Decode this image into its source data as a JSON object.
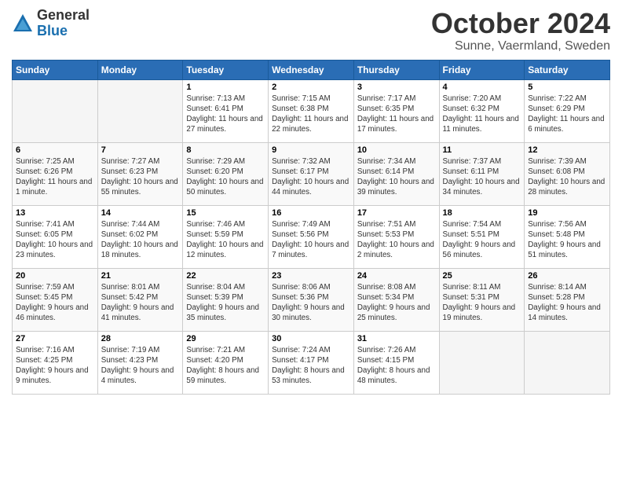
{
  "logo": {
    "general": "General",
    "blue": "Blue"
  },
  "title": "October 2024",
  "location": "Sunne, Vaermland, Sweden",
  "headers": [
    "Sunday",
    "Monday",
    "Tuesday",
    "Wednesday",
    "Thursday",
    "Friday",
    "Saturday"
  ],
  "weeks": [
    [
      {
        "day": "",
        "info": ""
      },
      {
        "day": "",
        "info": ""
      },
      {
        "day": "1",
        "info": "Sunrise: 7:13 AM\nSunset: 6:41 PM\nDaylight: 11 hours and 27 minutes."
      },
      {
        "day": "2",
        "info": "Sunrise: 7:15 AM\nSunset: 6:38 PM\nDaylight: 11 hours and 22 minutes."
      },
      {
        "day": "3",
        "info": "Sunrise: 7:17 AM\nSunset: 6:35 PM\nDaylight: 11 hours and 17 minutes."
      },
      {
        "day": "4",
        "info": "Sunrise: 7:20 AM\nSunset: 6:32 PM\nDaylight: 11 hours and 11 minutes."
      },
      {
        "day": "5",
        "info": "Sunrise: 7:22 AM\nSunset: 6:29 PM\nDaylight: 11 hours and 6 minutes."
      }
    ],
    [
      {
        "day": "6",
        "info": "Sunrise: 7:25 AM\nSunset: 6:26 PM\nDaylight: 11 hours and 1 minute."
      },
      {
        "day": "7",
        "info": "Sunrise: 7:27 AM\nSunset: 6:23 PM\nDaylight: 10 hours and 55 minutes."
      },
      {
        "day": "8",
        "info": "Sunrise: 7:29 AM\nSunset: 6:20 PM\nDaylight: 10 hours and 50 minutes."
      },
      {
        "day": "9",
        "info": "Sunrise: 7:32 AM\nSunset: 6:17 PM\nDaylight: 10 hours and 44 minutes."
      },
      {
        "day": "10",
        "info": "Sunrise: 7:34 AM\nSunset: 6:14 PM\nDaylight: 10 hours and 39 minutes."
      },
      {
        "day": "11",
        "info": "Sunrise: 7:37 AM\nSunset: 6:11 PM\nDaylight: 10 hours and 34 minutes."
      },
      {
        "day": "12",
        "info": "Sunrise: 7:39 AM\nSunset: 6:08 PM\nDaylight: 10 hours and 28 minutes."
      }
    ],
    [
      {
        "day": "13",
        "info": "Sunrise: 7:41 AM\nSunset: 6:05 PM\nDaylight: 10 hours and 23 minutes."
      },
      {
        "day": "14",
        "info": "Sunrise: 7:44 AM\nSunset: 6:02 PM\nDaylight: 10 hours and 18 minutes."
      },
      {
        "day": "15",
        "info": "Sunrise: 7:46 AM\nSunset: 5:59 PM\nDaylight: 10 hours and 12 minutes."
      },
      {
        "day": "16",
        "info": "Sunrise: 7:49 AM\nSunset: 5:56 PM\nDaylight: 10 hours and 7 minutes."
      },
      {
        "day": "17",
        "info": "Sunrise: 7:51 AM\nSunset: 5:53 PM\nDaylight: 10 hours and 2 minutes."
      },
      {
        "day": "18",
        "info": "Sunrise: 7:54 AM\nSunset: 5:51 PM\nDaylight: 9 hours and 56 minutes."
      },
      {
        "day": "19",
        "info": "Sunrise: 7:56 AM\nSunset: 5:48 PM\nDaylight: 9 hours and 51 minutes."
      }
    ],
    [
      {
        "day": "20",
        "info": "Sunrise: 7:59 AM\nSunset: 5:45 PM\nDaylight: 9 hours and 46 minutes."
      },
      {
        "day": "21",
        "info": "Sunrise: 8:01 AM\nSunset: 5:42 PM\nDaylight: 9 hours and 41 minutes."
      },
      {
        "day": "22",
        "info": "Sunrise: 8:04 AM\nSunset: 5:39 PM\nDaylight: 9 hours and 35 minutes."
      },
      {
        "day": "23",
        "info": "Sunrise: 8:06 AM\nSunset: 5:36 PM\nDaylight: 9 hours and 30 minutes."
      },
      {
        "day": "24",
        "info": "Sunrise: 8:08 AM\nSunset: 5:34 PM\nDaylight: 9 hours and 25 minutes."
      },
      {
        "day": "25",
        "info": "Sunrise: 8:11 AM\nSunset: 5:31 PM\nDaylight: 9 hours and 19 minutes."
      },
      {
        "day": "26",
        "info": "Sunrise: 8:14 AM\nSunset: 5:28 PM\nDaylight: 9 hours and 14 minutes."
      }
    ],
    [
      {
        "day": "27",
        "info": "Sunrise: 7:16 AM\nSunset: 4:25 PM\nDaylight: 9 hours and 9 minutes."
      },
      {
        "day": "28",
        "info": "Sunrise: 7:19 AM\nSunset: 4:23 PM\nDaylight: 9 hours and 4 minutes."
      },
      {
        "day": "29",
        "info": "Sunrise: 7:21 AM\nSunset: 4:20 PM\nDaylight: 8 hours and 59 minutes."
      },
      {
        "day": "30",
        "info": "Sunrise: 7:24 AM\nSunset: 4:17 PM\nDaylight: 8 hours and 53 minutes."
      },
      {
        "day": "31",
        "info": "Sunrise: 7:26 AM\nSunset: 4:15 PM\nDaylight: 8 hours and 48 minutes."
      },
      {
        "day": "",
        "info": ""
      },
      {
        "day": "",
        "info": ""
      }
    ]
  ]
}
